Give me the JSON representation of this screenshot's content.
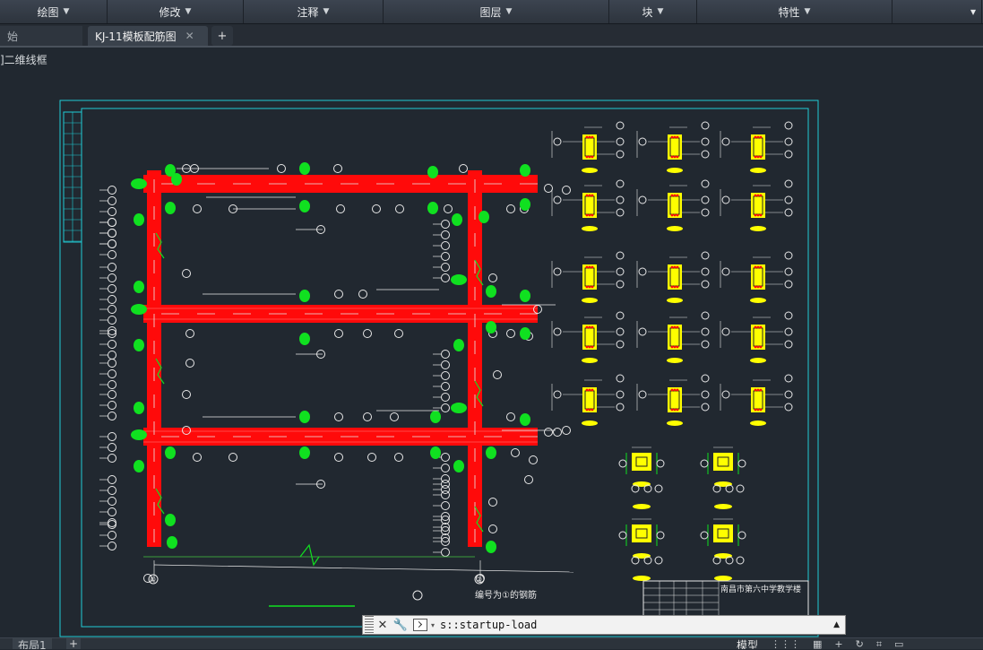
{
  "ribbon": {
    "panels": [
      {
        "label": "绘图",
        "width": 120
      },
      {
        "label": "修改",
        "width": 152
      },
      {
        "label": "注释",
        "width": 156
      },
      {
        "label": "图层",
        "width": 252
      },
      {
        "label": "块",
        "width": 98
      },
      {
        "label": "特性",
        "width": 218
      }
    ],
    "overflow_icon": "▾"
  },
  "tabs": {
    "start_label": "始",
    "active_label": "KJ-11模板配筋图",
    "close_glyph": "✕",
    "new_tab_glyph": "+"
  },
  "viewport": {
    "label": "]二维线框"
  },
  "drawing": {
    "texts": {
      "caption": "编号为①的钢筋",
      "title_block_name": "南昌市第六中学教学楼",
      "axis_left": "①",
      "axis_right": "②"
    },
    "colors": {
      "background": "#212830",
      "frame": "#21cdd6",
      "line": "#e8e8e8",
      "rebar": "#ff0a0a",
      "marker": "#10e020",
      "section": "#ffff00",
      "dim": "#3c9e3c"
    }
  },
  "command": {
    "close_glyph": "✕",
    "settings_glyph": "🔧",
    "dropdown_glyph": "▾",
    "text": "s::startup-load",
    "up_glyph": "▲"
  },
  "status": {
    "layout_tab": "布局1",
    "plus_glyph": "+",
    "model_label": "模型",
    "icons": [
      "⋮⋮⋮",
      "▦",
      "+",
      "↻",
      "⌗",
      "▭"
    ]
  }
}
